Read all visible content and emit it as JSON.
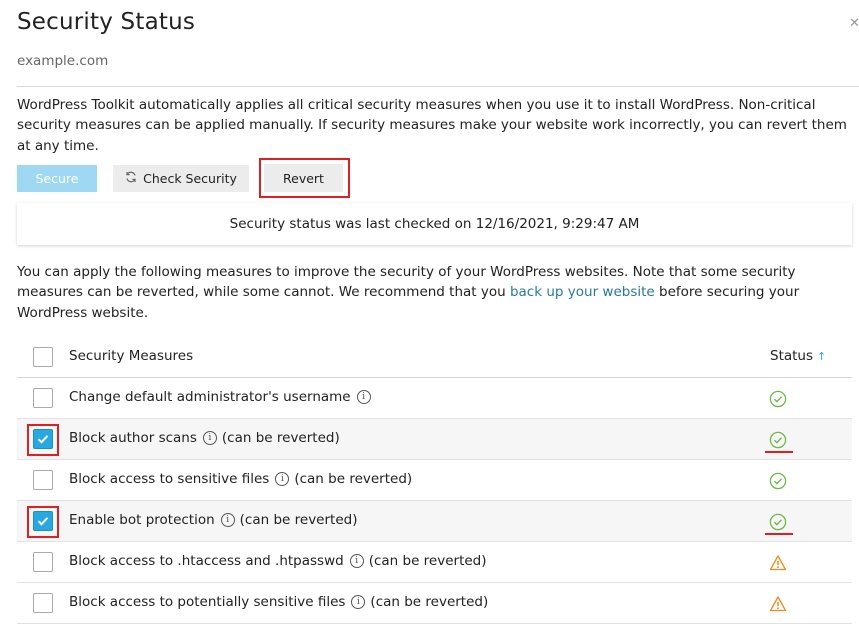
{
  "dialog": {
    "title": "Security Status",
    "close_icon": "close-icon",
    "domain": "example.com"
  },
  "intro_text": "WordPress Toolkit automatically applies all critical security measures when you use it to install WordPress. Non-critical security measures can be applied manually. If security measures make your website work incorrectly, you can revert them at any time.",
  "toolbar": {
    "secure_label": "Secure",
    "check_label": "Check Security",
    "check_icon": "refresh-icon",
    "revert_label": "Revert"
  },
  "last_checked": "Security status was last checked on 12/16/2021, 9:29:47 AM",
  "info": {
    "before_link": "You can apply the following measures to improve the security of your WordPress websites. Note that some security measures can be reverted, while some cannot. We recommend that you ",
    "link_text": "back up your website",
    "after_link": " before securing your WordPress website."
  },
  "table": {
    "header_measures": "Security Measures",
    "header_status": "Status",
    "sort_indicator": "↑",
    "rows": [
      {
        "label": "Change default administrator's username",
        "suffix": "",
        "checked": false,
        "status": "ok"
      },
      {
        "label": "Block author scans",
        "suffix": "(can be reverted)",
        "checked": true,
        "status": "ok"
      },
      {
        "label": "Block access to sensitive files",
        "suffix": "(can be reverted)",
        "checked": false,
        "status": "ok"
      },
      {
        "label": "Enable bot protection",
        "suffix": "(can be reverted)",
        "checked": true,
        "status": "ok"
      },
      {
        "label": "Block access to .htaccess and .htpasswd",
        "suffix": "(can be reverted)",
        "checked": false,
        "status": "warning"
      },
      {
        "label": "Block access to potentially sensitive files",
        "suffix": "(can be reverted)",
        "checked": false,
        "status": "warning"
      }
    ]
  },
  "colors": {
    "accent": "#28a8e0",
    "ok": "#6fb84a",
    "warning": "#f08a1c",
    "highlight": "#e02020",
    "link": "#28799e"
  }
}
